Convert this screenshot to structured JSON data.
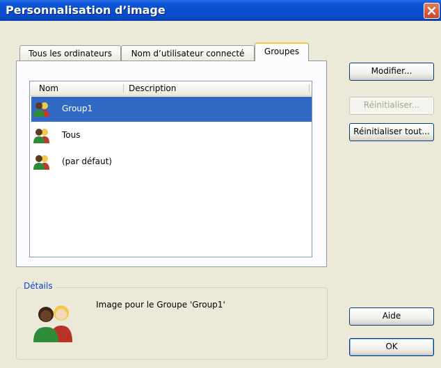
{
  "window": {
    "title": "Personnalisation d’image"
  },
  "tabs": [
    {
      "label": "Tous les ordinateurs"
    },
    {
      "label": "Nom d’utilisateur connecté"
    },
    {
      "label": "Groupes"
    }
  ],
  "list": {
    "columns": [
      "Nom",
      "Description"
    ],
    "rows": [
      {
        "name": "Group1",
        "selected": true
      },
      {
        "name": "Tous",
        "selected": false
      },
      {
        "name": "(par défaut)",
        "selected": false
      }
    ]
  },
  "buttons": {
    "modifier": "Modifier...",
    "reinitialiser": "Réinitialiser...",
    "reinitialiser_tout": "Réinitialiser tout...",
    "aide": "Aide",
    "ok": "OK"
  },
  "details": {
    "label": "Détails",
    "text": "Image pour le Groupe 'Group1'"
  },
  "icons": {
    "close": "close-icon",
    "group": "user-group-icon"
  },
  "colors": {
    "titlebar": "#0a4fd0",
    "selection": "#316ac5",
    "tab_accent": "#ffc83c",
    "group_label": "#0046d5"
  }
}
